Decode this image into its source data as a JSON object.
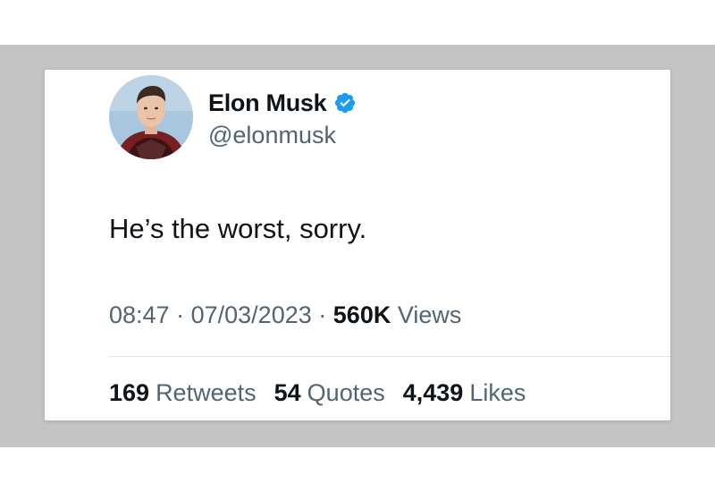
{
  "tweet": {
    "display_name": "Elon Musk",
    "handle": "@elonmusk",
    "verified": true,
    "text": "He’s the worst, sorry.",
    "time": "08:47",
    "separator": "·",
    "date": "07/03/2023",
    "views_count": "560K",
    "views_label": "Views"
  },
  "stats": [
    {
      "count": "169",
      "label": "Retweets"
    },
    {
      "count": "54",
      "label": "Quotes"
    },
    {
      "count": "4,439",
      "label": "Likes"
    }
  ],
  "colors": {
    "backdrop": "#c4c4c4",
    "card": "#ffffff",
    "primary_text": "#0f1419",
    "secondary_text": "#536471",
    "verified_badge": "#1d9bf0",
    "divider": "#e1e8ed"
  }
}
